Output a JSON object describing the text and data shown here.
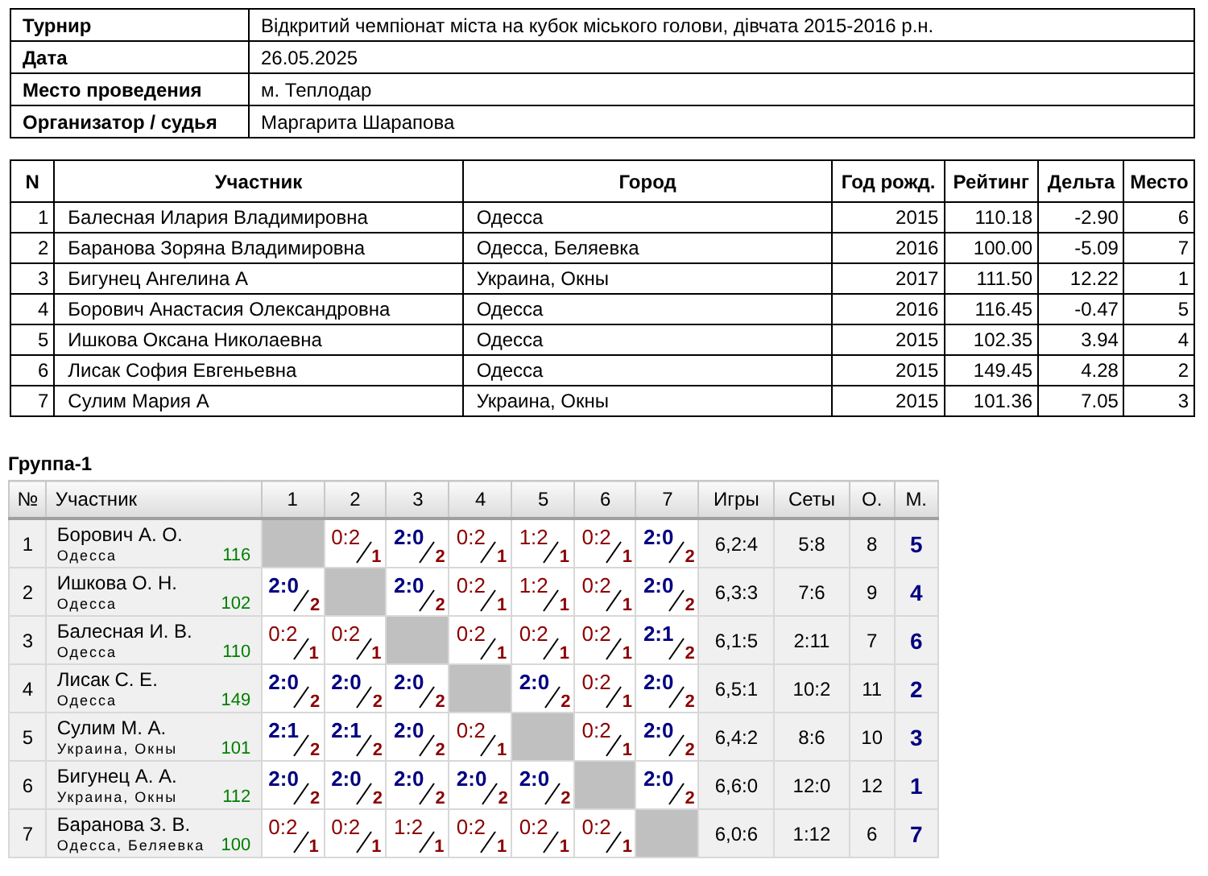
{
  "info": [
    {
      "label": "Турнир",
      "value": "Відкритий чемпіонат міста на кубок міського голови, дівчата 2015-2016 р.н."
    },
    {
      "label": "Дата",
      "value": "26.05.2025"
    },
    {
      "label": "Место проведения",
      "value": "м. Теплодар"
    },
    {
      "label": "Организатор / судья",
      "value": "Маргарита Шарапова"
    }
  ],
  "participants": {
    "columns": [
      "N",
      "Участник",
      "Город",
      "Год рожд.",
      "Рейтинг",
      "Дельта",
      "Место"
    ],
    "rows": [
      [
        "1",
        "Балесная Илария Владимировна",
        "Одесса",
        "2015",
        "110.18",
        "-2.90",
        "6"
      ],
      [
        "2",
        "Баранова Зоряна Владимировна",
        "Одесса, Беляевка",
        "2016",
        "100.00",
        "-5.09",
        "7"
      ],
      [
        "3",
        "Бигунец Ангелина А",
        "Украина, Окны",
        "2017",
        "111.50",
        "12.22",
        "1"
      ],
      [
        "4",
        "Борович Анастасия Олександровна",
        "Одесса",
        "2016",
        "116.45",
        "-0.47",
        "5"
      ],
      [
        "5",
        "Ишкова Оксана Николаевна",
        "Одесса",
        "2015",
        "102.35",
        "3.94",
        "4"
      ],
      [
        "6",
        "Лисак София Евгеньевна",
        "Одесса",
        "2015",
        "149.45",
        "4.28",
        "2"
      ],
      [
        "7",
        "Сулим Мария А",
        "Украина, Окны",
        "2015",
        "101.36",
        "7.05",
        "3"
      ]
    ]
  },
  "group": {
    "title": "Группа-1",
    "columns": [
      "№",
      "Участник",
      "1",
      "2",
      "3",
      "4",
      "5",
      "6",
      "7",
      "Игры",
      "Сеты",
      "О.",
      "М."
    ],
    "rows": [
      {
        "no": "1",
        "name": "Борович А. О.",
        "city": "Одесса",
        "rating": "116",
        "results": [
          {
            "kind": "self"
          },
          {
            "kind": "match",
            "score": "0:2",
            "points": "1",
            "win": false
          },
          {
            "kind": "match",
            "score": "2:0",
            "points": "2",
            "win": true
          },
          {
            "kind": "match",
            "score": "0:2",
            "points": "1",
            "win": false
          },
          {
            "kind": "match",
            "score": "1:2",
            "points": "1",
            "win": false
          },
          {
            "kind": "match",
            "score": "0:2",
            "points": "1",
            "win": false
          },
          {
            "kind": "match",
            "score": "2:0",
            "points": "2",
            "win": true
          }
        ],
        "games": "6,2:4",
        "sets": "5:8",
        "points": "8",
        "place": "5"
      },
      {
        "no": "2",
        "name": "Ишкова О. Н.",
        "city": "Одесса",
        "rating": "102",
        "results": [
          {
            "kind": "match",
            "score": "2:0",
            "points": "2",
            "win": true
          },
          {
            "kind": "self"
          },
          {
            "kind": "match",
            "score": "2:0",
            "points": "2",
            "win": true
          },
          {
            "kind": "match",
            "score": "0:2",
            "points": "1",
            "win": false
          },
          {
            "kind": "match",
            "score": "1:2",
            "points": "1",
            "win": false
          },
          {
            "kind": "match",
            "score": "0:2",
            "points": "1",
            "win": false
          },
          {
            "kind": "match",
            "score": "2:0",
            "points": "2",
            "win": true
          }
        ],
        "games": "6,3:3",
        "sets": "7:6",
        "points": "9",
        "place": "4"
      },
      {
        "no": "3",
        "name": "Балесная И. В.",
        "city": "Одесса",
        "rating": "110",
        "results": [
          {
            "kind": "match",
            "score": "0:2",
            "points": "1",
            "win": false
          },
          {
            "kind": "match",
            "score": "0:2",
            "points": "1",
            "win": false
          },
          {
            "kind": "self"
          },
          {
            "kind": "match",
            "score": "0:2",
            "points": "1",
            "win": false
          },
          {
            "kind": "match",
            "score": "0:2",
            "points": "1",
            "win": false
          },
          {
            "kind": "match",
            "score": "0:2",
            "points": "1",
            "win": false
          },
          {
            "kind": "match",
            "score": "2:1",
            "points": "2",
            "win": true
          }
        ],
        "games": "6,1:5",
        "sets": "2:11",
        "points": "7",
        "place": "6"
      },
      {
        "no": "4",
        "name": "Лисак С. Е.",
        "city": "Одесса",
        "rating": "149",
        "results": [
          {
            "kind": "match",
            "score": "2:0",
            "points": "2",
            "win": true
          },
          {
            "kind": "match",
            "score": "2:0",
            "points": "2",
            "win": true
          },
          {
            "kind": "match",
            "score": "2:0",
            "points": "2",
            "win": true
          },
          {
            "kind": "self"
          },
          {
            "kind": "match",
            "score": "2:0",
            "points": "2",
            "win": true
          },
          {
            "kind": "match",
            "score": "0:2",
            "points": "1",
            "win": false
          },
          {
            "kind": "match",
            "score": "2:0",
            "points": "2",
            "win": true
          }
        ],
        "games": "6,5:1",
        "sets": "10:2",
        "points": "11",
        "place": "2"
      },
      {
        "no": "5",
        "name": "Сулим М. А.",
        "city": "Украина, Окны",
        "rating": "101",
        "results": [
          {
            "kind": "match",
            "score": "2:1",
            "points": "2",
            "win": true
          },
          {
            "kind": "match",
            "score": "2:1",
            "points": "2",
            "win": true
          },
          {
            "kind": "match",
            "score": "2:0",
            "points": "2",
            "win": true
          },
          {
            "kind": "match",
            "score": "0:2",
            "points": "1",
            "win": false
          },
          {
            "kind": "self"
          },
          {
            "kind": "match",
            "score": "0:2",
            "points": "1",
            "win": false
          },
          {
            "kind": "match",
            "score": "2:0",
            "points": "2",
            "win": true
          }
        ],
        "games": "6,4:2",
        "sets": "8:6",
        "points": "10",
        "place": "3"
      },
      {
        "no": "6",
        "name": "Бигунец А. А.",
        "city": "Украина, Окны",
        "rating": "112",
        "results": [
          {
            "kind": "match",
            "score": "2:0",
            "points": "2",
            "win": true
          },
          {
            "kind": "match",
            "score": "2:0",
            "points": "2",
            "win": true
          },
          {
            "kind": "match",
            "score": "2:0",
            "points": "2",
            "win": true
          },
          {
            "kind": "match",
            "score": "2:0",
            "points": "2",
            "win": true
          },
          {
            "kind": "match",
            "score": "2:0",
            "points": "2",
            "win": true
          },
          {
            "kind": "self"
          },
          {
            "kind": "match",
            "score": "2:0",
            "points": "2",
            "win": true
          }
        ],
        "games": "6,6:0",
        "sets": "12:0",
        "points": "12",
        "place": "1"
      },
      {
        "no": "7",
        "name": "Баранова З. В.",
        "city": "Одесса, Беляевка",
        "rating": "100",
        "results": [
          {
            "kind": "match",
            "score": "0:2",
            "points": "1",
            "win": false
          },
          {
            "kind": "match",
            "score": "0:2",
            "points": "1",
            "win": false
          },
          {
            "kind": "match",
            "score": "1:2",
            "points": "1",
            "win": false
          },
          {
            "kind": "match",
            "score": "0:2",
            "points": "1",
            "win": false
          },
          {
            "kind": "match",
            "score": "0:2",
            "points": "1",
            "win": false
          },
          {
            "kind": "match",
            "score": "0:2",
            "points": "1",
            "win": false
          },
          {
            "kind": "self"
          }
        ],
        "games": "6,0:6",
        "sets": "1:12",
        "points": "6",
        "place": "7"
      }
    ]
  }
}
